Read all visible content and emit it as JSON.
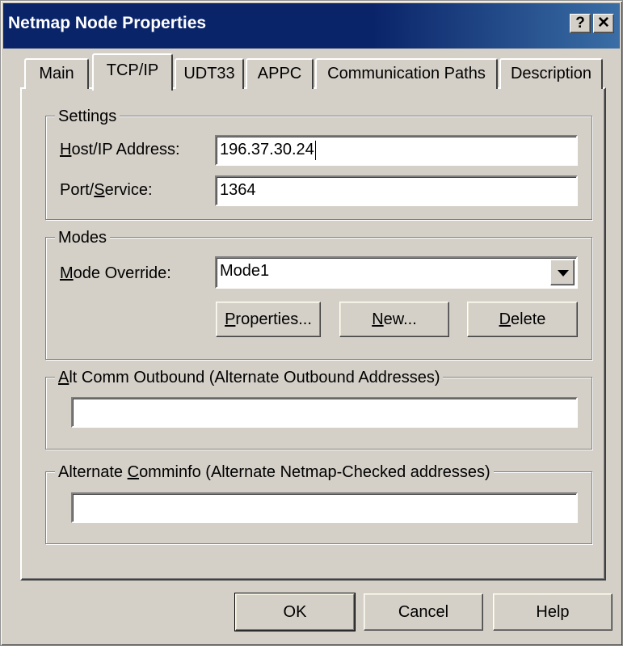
{
  "window": {
    "title": "Netmap Node Properties",
    "help_button": "?",
    "close_button": "✕"
  },
  "tabs": [
    {
      "label": "Main",
      "active": false
    },
    {
      "label": "TCP/IP",
      "active": true
    },
    {
      "label": "UDT33",
      "active": false
    },
    {
      "label": "APPC",
      "active": false
    },
    {
      "label": "Communication Paths",
      "active": false
    },
    {
      "label": "Description",
      "active": false
    }
  ],
  "settings": {
    "title": "Settings",
    "host_label_u": "H",
    "host_label_rest": "ost/IP Address:",
    "host_value": "196.37.30.24",
    "port_label_a": "Port/",
    "port_label_u": "S",
    "port_label_b": "ervice:",
    "port_value": "1364"
  },
  "modes": {
    "title": "Modes",
    "override_label_u": "M",
    "override_label_rest": "ode Override:",
    "override_value": "Mode1",
    "properties_u": "P",
    "properties_rest": "roperties...",
    "new_u": "N",
    "new_rest": "ew...",
    "delete_u": "D",
    "delete_rest": "elete"
  },
  "alt_comm": {
    "title_u": "A",
    "title_rest": "lt Comm Outbound  (Alternate Outbound Addresses)",
    "value": ""
  },
  "alt_comminfo": {
    "title_a": "Alternate ",
    "title_u": "C",
    "title_b": "omminfo  (Alternate Netmap-Checked addresses)",
    "value": ""
  },
  "footer": {
    "ok_label": "OK",
    "cancel_label": "Cancel",
    "help_label": "Help"
  }
}
